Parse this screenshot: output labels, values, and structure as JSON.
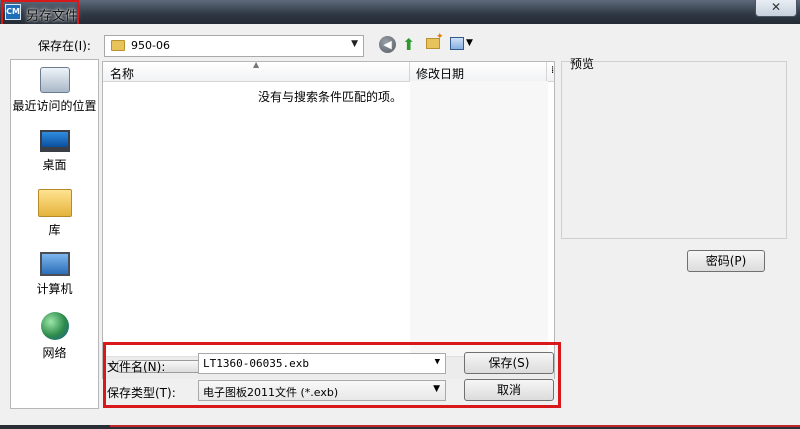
{
  "window": {
    "title": "另存文件",
    "close_label": "✕",
    "app_icon_label": "CM"
  },
  "toolbar": {
    "save_in_label": "保存在(I):",
    "save_in_value": "950-06",
    "back_icon": "back-arrow-icon",
    "up_icon": "up-folder-icon",
    "new_folder_icon": "new-folder-icon",
    "view_icon": "view-menu-icon"
  },
  "places": [
    {
      "label": "最近访问的位置",
      "icon": "recent-places-icon"
    },
    {
      "label": "桌面",
      "icon": "desktop-icon"
    },
    {
      "label": "库",
      "icon": "libraries-icon"
    },
    {
      "label": "计算机",
      "icon": "computer-icon"
    },
    {
      "label": "网络",
      "icon": "network-icon"
    }
  ],
  "file_list": {
    "columns": [
      "名称",
      "修改日期"
    ],
    "empty_message": "没有与搜索条件匹配的项。"
  },
  "preview": {
    "label": "预览",
    "password_button": "密码(P)"
  },
  "form": {
    "filename_label": "文件名(N):",
    "filename_value": "LT1360-06035.exb",
    "filetype_label": "保存类型(T):",
    "filetype_value": "电子图板2011文件 (*.exb)",
    "save_button": "保存(S)",
    "cancel_button": "取消"
  },
  "colors": {
    "highlight": "#d7191c",
    "dialog_background": "#f0f0f0"
  }
}
